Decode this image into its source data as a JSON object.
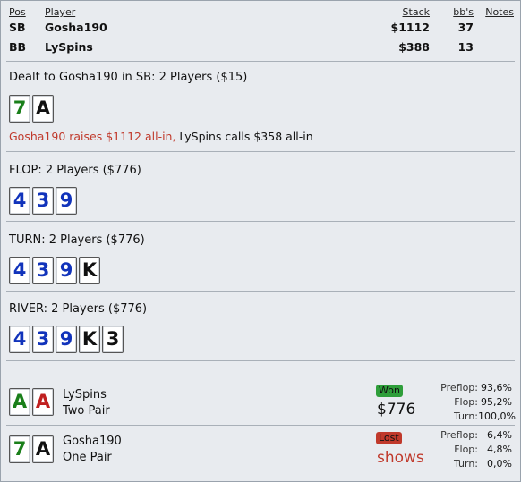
{
  "header": {
    "columns": {
      "pos": "Pos",
      "player": "Player",
      "stack": "Stack",
      "bbs": "bb's",
      "notes": "Notes"
    },
    "players": [
      {
        "pos": "SB",
        "name": "Gosha190",
        "stack": "$1112",
        "bbs": "37"
      },
      {
        "pos": "BB",
        "name": "LySpins",
        "stack": "$388",
        "bbs": "13"
      }
    ]
  },
  "preflop": {
    "title": "Dealt to Gosha190 in SB: 2 Players ($15)",
    "cards": [
      {
        "rank": "7",
        "suit": "clubs"
      },
      {
        "rank": "A",
        "suit": "spades"
      }
    ],
    "action_red": "Gosha190 raises $1112 all-in,",
    "action_black": " LySpins calls $358 all-in"
  },
  "flop": {
    "title": "FLOP: 2 Players ($776)",
    "cards": [
      {
        "rank": "4",
        "suit": "diamonds"
      },
      {
        "rank": "3",
        "suit": "diamonds"
      },
      {
        "rank": "9",
        "suit": "diamonds"
      }
    ]
  },
  "turn": {
    "title": "TURN: 2 Players ($776)",
    "cards": [
      {
        "rank": "4",
        "suit": "diamonds"
      },
      {
        "rank": "3",
        "suit": "diamonds"
      },
      {
        "rank": "9",
        "suit": "diamonds"
      },
      {
        "rank": "K",
        "suit": "spades"
      }
    ]
  },
  "river": {
    "title": "RIVER: 2 Players ($776)",
    "cards": [
      {
        "rank": "4",
        "suit": "diamonds"
      },
      {
        "rank": "3",
        "suit": "diamonds"
      },
      {
        "rank": "9",
        "suit": "diamonds"
      },
      {
        "rank": "K",
        "suit": "spades"
      },
      {
        "rank": "3",
        "suit": "spades"
      }
    ]
  },
  "results": [
    {
      "name": "LySpins",
      "hand": "Two Pair",
      "cards": [
        {
          "rank": "A",
          "suit": "clubs"
        },
        {
          "rank": "A",
          "suit": "hearts"
        }
      ],
      "badge": "Won",
      "amount": "$776",
      "equity": {
        "preflop_label": "Preflop:",
        "preflop": "93,6%",
        "flop_label": "Flop:",
        "flop": "95,2%",
        "turn_label": "Turn:",
        "turn": "100,0%"
      }
    },
    {
      "name": "Gosha190",
      "hand": "One Pair",
      "cards": [
        {
          "rank": "7",
          "suit": "clubs"
        },
        {
          "rank": "A",
          "suit": "spades"
        }
      ],
      "badge": "Lost",
      "amount": "shows",
      "equity": {
        "preflop_label": "Preflop:",
        "preflop": "6,4%",
        "flop_label": "Flop:",
        "flop": "4,8%",
        "turn_label": "Turn:",
        "turn": "0,0%"
      }
    }
  ],
  "colors": {
    "won": "#2e9e3a",
    "lost": "#c0392b",
    "diamonds": "#1133bb",
    "clubs": "#1a7f1a",
    "hearts": "#c02020",
    "spades": "#111111"
  }
}
